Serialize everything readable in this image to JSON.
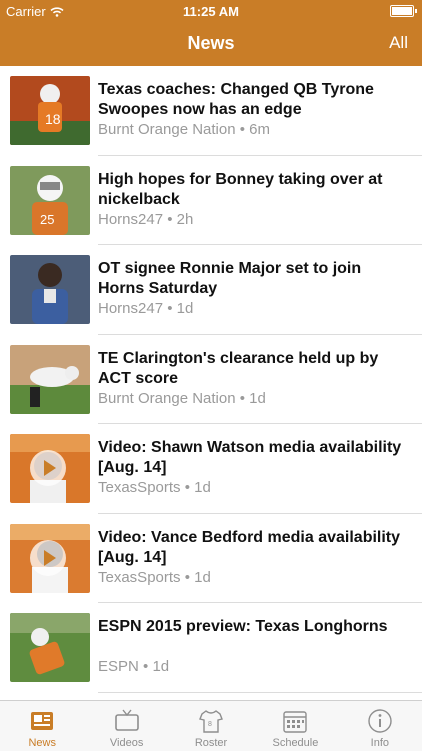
{
  "status_bar": {
    "carrier": "Carrier",
    "time": "11:25 AM"
  },
  "nav": {
    "title": "News",
    "right_button": "All"
  },
  "colors": {
    "accent": "#c97d27",
    "meta_text": "#9a9a9a",
    "tab_inactive": "#8e8e8e"
  },
  "articles": [
    {
      "headline": "Texas coaches: Changed QB Tyrone Swoopes now has an edge",
      "source": "Burnt Orange Nation",
      "age": "6m",
      "video": false
    },
    {
      "headline": "High hopes for Bonney taking over at nickelback",
      "source": "Horns247",
      "age": "2h",
      "video": false
    },
    {
      "headline": "OT signee Ronnie Major set to join Horns Saturday",
      "source": "Horns247",
      "age": "1d",
      "video": false
    },
    {
      "headline": "TE Clarington's clearance held up by ACT score",
      "source": "Burnt Orange Nation",
      "age": "1d",
      "video": false
    },
    {
      "headline": "Video: Shawn Watson media availability [Aug. 14]",
      "source": "TexasSports",
      "age": "1d",
      "video": true
    },
    {
      "headline": "Video: Vance Bedford media availability [Aug. 14]",
      "source": "TexasSports",
      "age": "1d",
      "video": true
    },
    {
      "headline": "ESPN 2015 preview: Texas Longhorns",
      "source": "ESPN",
      "age": "1d",
      "video": false
    }
  ],
  "tabs": [
    {
      "label": "News",
      "icon": "newspaper-icon",
      "active": true
    },
    {
      "label": "Videos",
      "icon": "tv-icon",
      "active": false
    },
    {
      "label": "Roster",
      "icon": "jersey-icon",
      "active": false
    },
    {
      "label": "Schedule",
      "icon": "calendar-icon",
      "active": false
    },
    {
      "label": "Info",
      "icon": "info-icon",
      "active": false
    }
  ]
}
